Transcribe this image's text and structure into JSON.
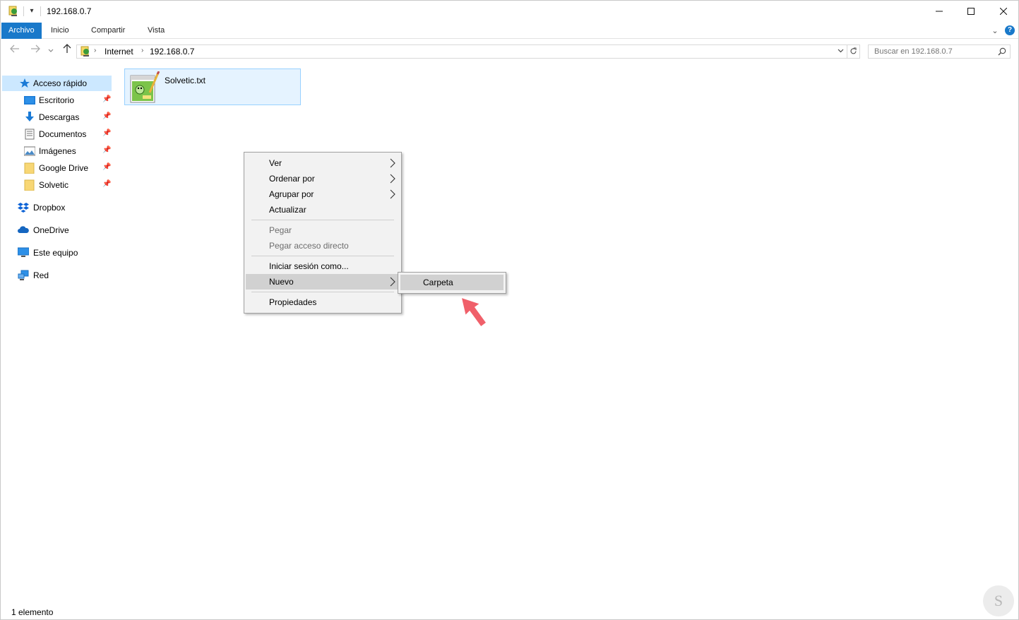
{
  "window": {
    "title": "192.168.0.7",
    "qa_arrow": "▾",
    "min_icon": "minimize-icon",
    "max_icon": "maximize-icon",
    "close_icon": "close-icon"
  },
  "ribbon": {
    "tabs": [
      {
        "label": "Archivo"
      },
      {
        "label": "Inicio"
      },
      {
        "label": "Compartir"
      },
      {
        "label": "Vista"
      }
    ],
    "chevron": "⌄",
    "help": "?"
  },
  "address": {
    "crumbs": [
      "Internet",
      "192.168.0.7"
    ],
    "search_placeholder": "Buscar en 192.168.0.7"
  },
  "nav": {
    "items": [
      {
        "label": "Acceso rápido",
        "icon": "star-icon",
        "selected": true
      },
      {
        "label": "Escritorio",
        "icon": "desktop-icon",
        "pinned": true
      },
      {
        "label": "Descargas",
        "icon": "download-icon",
        "pinned": true
      },
      {
        "label": "Documentos",
        "icon": "document-icon",
        "pinned": true
      },
      {
        "label": "Imágenes",
        "icon": "pictures-icon",
        "pinned": true
      },
      {
        "label": "Google Drive",
        "icon": "folder-icon",
        "pinned": true
      },
      {
        "label": "Solvetic",
        "icon": "folder-icon",
        "pinned": true
      },
      {
        "label": "Dropbox",
        "icon": "dropbox-icon"
      },
      {
        "label": "OneDrive",
        "icon": "cloud-icon"
      },
      {
        "label": "Este equipo",
        "icon": "computer-icon"
      },
      {
        "label": "Red",
        "icon": "network-icon"
      }
    ]
  },
  "content": {
    "files": [
      {
        "name": "Solvetic.txt",
        "icon": "notepad-plus-icon"
      }
    ]
  },
  "context_menu": {
    "items": [
      {
        "label": "Ver",
        "submenu": true
      },
      {
        "label": "Ordenar por",
        "submenu": true
      },
      {
        "label": "Agrupar por",
        "submenu": true
      },
      {
        "label": "Actualizar"
      },
      {
        "label": "Pegar",
        "disabled": true
      },
      {
        "label": "Pegar acceso directo",
        "disabled": true
      },
      {
        "label": "Iniciar sesión como..."
      },
      {
        "label": "Nuevo",
        "submenu": true,
        "hover": true
      },
      {
        "label": "Propiedades"
      }
    ],
    "submenu": {
      "items": [
        {
          "label": "Carpeta"
        }
      ]
    }
  },
  "status": {
    "text": "1 elemento"
  },
  "colors": {
    "accent": "#1979ca",
    "selection": "#cce8ff",
    "menu_hover": "#d1d1d1",
    "pointer": "#f0606a"
  }
}
